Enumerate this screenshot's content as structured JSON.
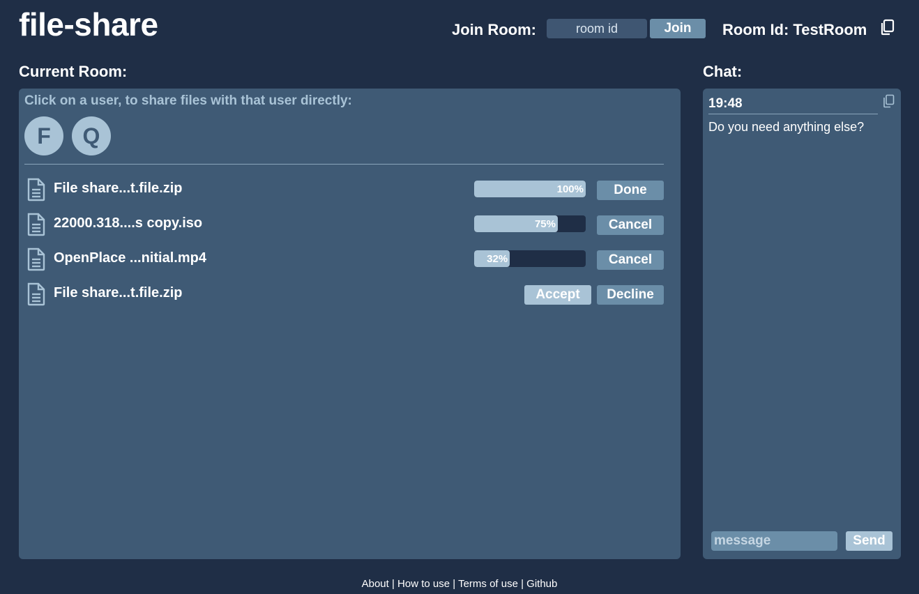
{
  "app": {
    "title": "file-share"
  },
  "header": {
    "join_label": "Join Room:",
    "room_input_placeholder": "room id",
    "join_button": "Join",
    "room_id_text": "Room Id: TestRoom"
  },
  "room": {
    "heading": "Current Room:",
    "hint": "Click on a user, to share files with that user directly:",
    "users": [
      "F",
      "Q"
    ],
    "files": [
      {
        "name": "File share...t.file.zip",
        "progress": 100,
        "progress_label": "100%",
        "action": "Done"
      },
      {
        "name": "22000.318....s copy.iso",
        "progress": 75,
        "progress_label": "75%",
        "action": "Cancel"
      },
      {
        "name": "OpenPlace ...nitial.mp4",
        "progress": 32,
        "progress_label": "32%",
        "action": "Cancel"
      },
      {
        "name": "File share...t.file.zip",
        "accept": "Accept",
        "decline": "Decline"
      }
    ]
  },
  "chat": {
    "heading": "Chat:",
    "messages": [
      {
        "time": "19:48",
        "text": "Do you need anything else?"
      }
    ],
    "input_placeholder": "message",
    "send_button": "Send"
  },
  "footer": {
    "links": [
      "About",
      "How to use",
      "Terms of use",
      "Github"
    ],
    "separator": " | "
  },
  "colors": {
    "background": "#1f2e46",
    "panel": "#3f5a75",
    "accent_light": "#a9c3d6",
    "accent_dark": "#6b8ea8"
  },
  "icons": {
    "file": "file-document-icon",
    "copy": "copy-icon"
  }
}
